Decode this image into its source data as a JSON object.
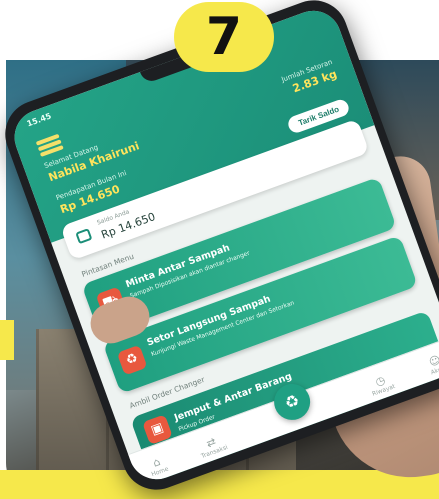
{
  "badge": {
    "number": "7"
  },
  "colors": {
    "accent": "#f6e84b",
    "app_primary": "#1fa083",
    "highlight": "#ffe45c",
    "alert": "#e8583e"
  },
  "phone": {
    "status_time": "15.45",
    "header": {
      "welcome_label": "Selamat Datang",
      "username": "Nabila Khairuni",
      "earnings_label": "Pendapatan Bulan Ini",
      "earnings_value": "Rp 14.650",
      "weight_label": "Jumlah Setoran",
      "weight_value": "2.83 kg",
      "withdraw_button": "Tarik Saldo"
    },
    "balance": {
      "label": "Saldo Anda",
      "value": "Rp 14.650",
      "icon": "wallet-icon"
    },
    "sections": {
      "menu": "Pintasan Menu",
      "order": "Ambil Order Changer"
    },
    "menu_items": [
      {
        "title": "Minta Antar Sampah",
        "desc": "Sampah Diposisikan akan diantar changer",
        "icon": "truck-icon"
      },
      {
        "title": "Setor Langsung Sampah",
        "desc": "Kunjungi Waste Management Center dan Setorkan",
        "icon": "recycle-icon"
      }
    ],
    "order_item": {
      "title": "Jemput & Antar Barang",
      "subtitle": "Pickup Order",
      "desc": "Ayo berpartisipasi untuk mengelola antar changer yang lain, mari buktikan akan menyalurkan para konsumen jugal ke Langsung ke order tersedia!",
      "icon": "package-icon"
    },
    "nav": [
      {
        "label": "Home",
        "icon": "home-icon"
      },
      {
        "label": "Transaksi",
        "icon": "transaction-icon"
      },
      {
        "label": "Setor",
        "icon": "recycle-icon"
      },
      {
        "label": "Riwayat",
        "icon": "history-icon"
      },
      {
        "label": "Akun",
        "icon": "user-icon"
      }
    ]
  }
}
